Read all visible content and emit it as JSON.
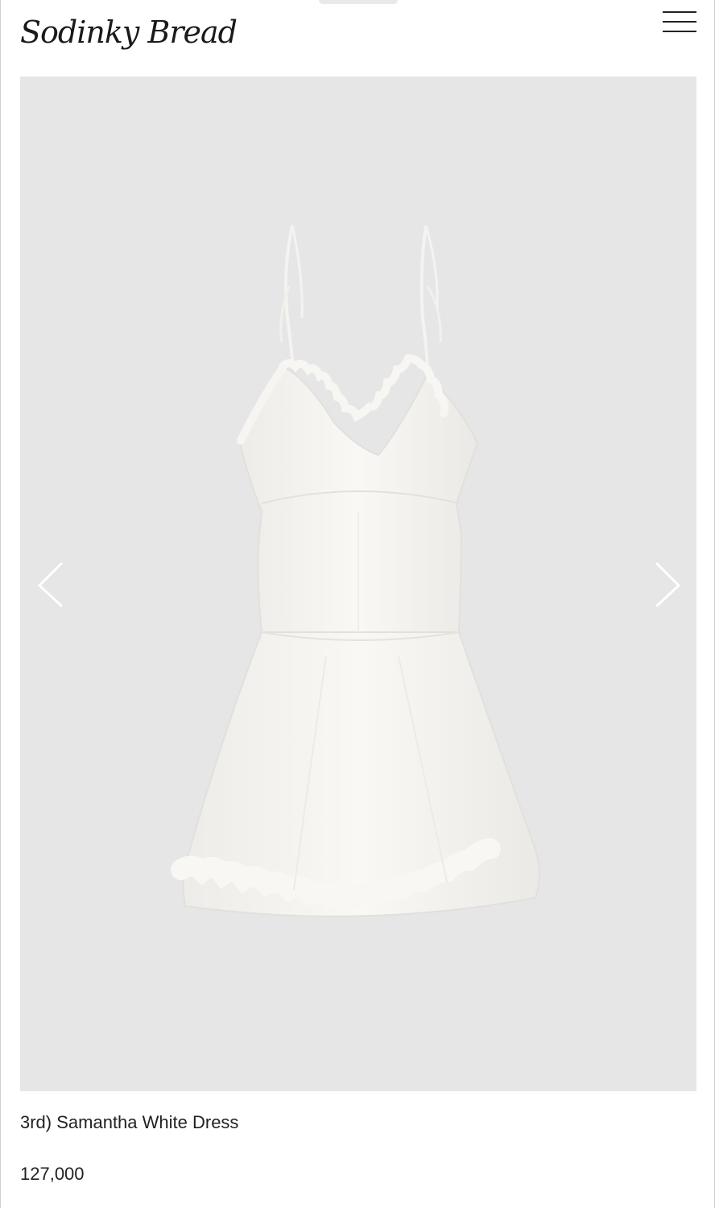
{
  "header": {
    "logo_text": "Sodinky Bread",
    "menu_icon": "hamburger-menu-icon"
  },
  "gallery": {
    "prev_icon": "chevron-left-icon",
    "next_icon": "chevron-right-icon",
    "image_subject": "white-dress-image"
  },
  "product": {
    "title": "3rd) Samantha White Dress",
    "price": "127,000"
  },
  "colors": {
    "background": "#ffffff",
    "gallery_background": "#e6e6e7",
    "text": "#222222",
    "dress": "#f7f6f3"
  }
}
